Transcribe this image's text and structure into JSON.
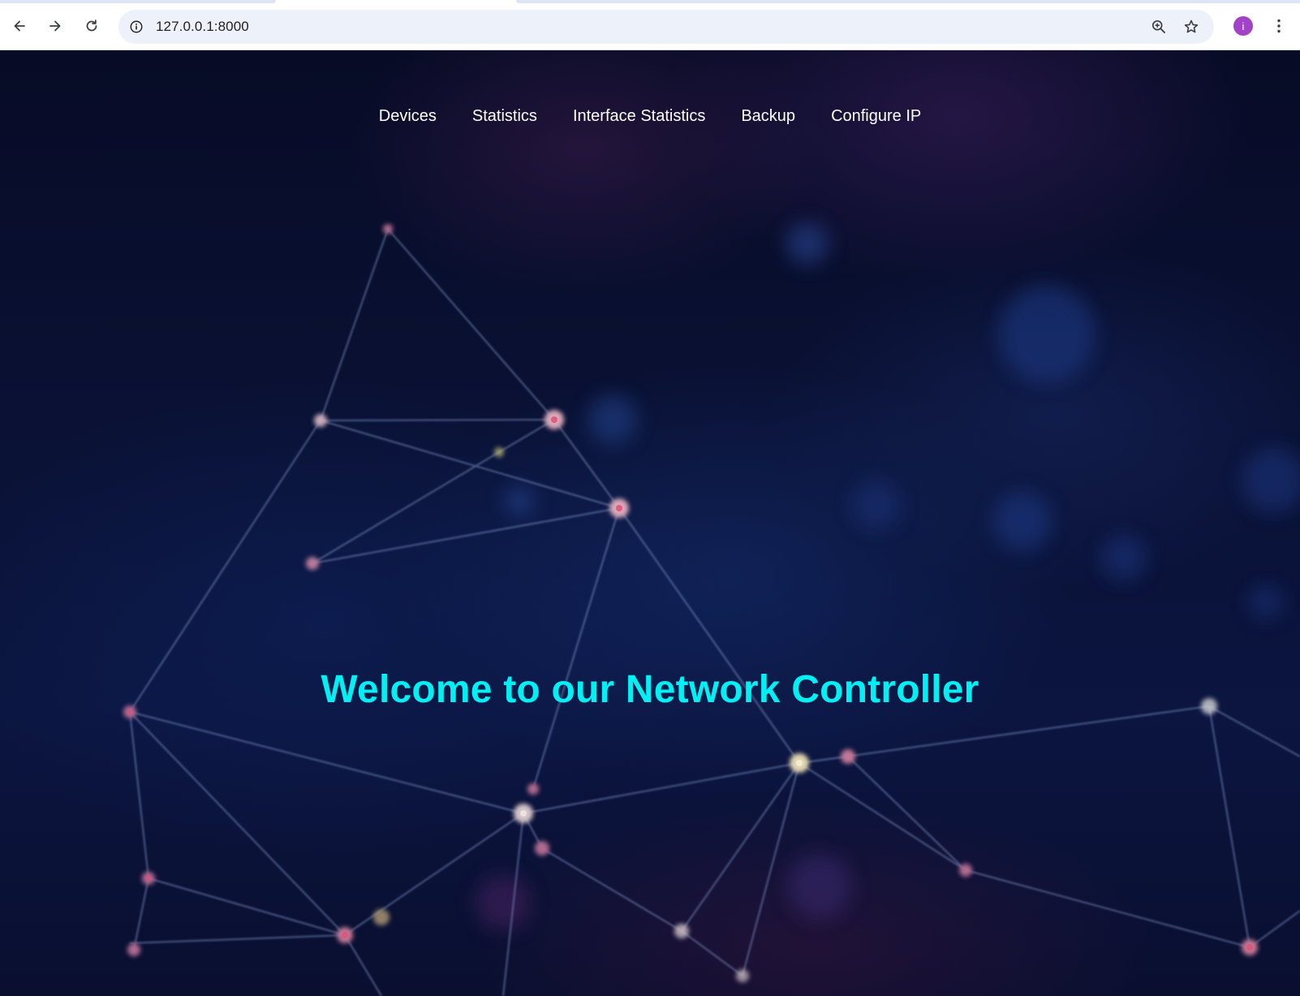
{
  "browser": {
    "url": "127.0.0.1:8000",
    "profile_initial": "i",
    "icons": {
      "back": "arrow-left-icon",
      "forward": "arrow-right-icon",
      "reload": "reload-icon",
      "site_info": "info-icon",
      "zoom": "zoom-in-icon",
      "bookmark": "star-icon",
      "menu": "kebab-menu-icon"
    }
  },
  "nav": {
    "items": [
      {
        "label": "Devices"
      },
      {
        "label": "Statistics"
      },
      {
        "label": "Interface Statistics"
      },
      {
        "label": "Backup"
      },
      {
        "label": "Configure IP"
      }
    ]
  },
  "hero": {
    "title": "Welcome to our Network Controller"
  },
  "colors": {
    "title": "#00f0f4",
    "nav_text": "#ffffff",
    "background": "#0a1236",
    "avatar": "#a142c8"
  }
}
